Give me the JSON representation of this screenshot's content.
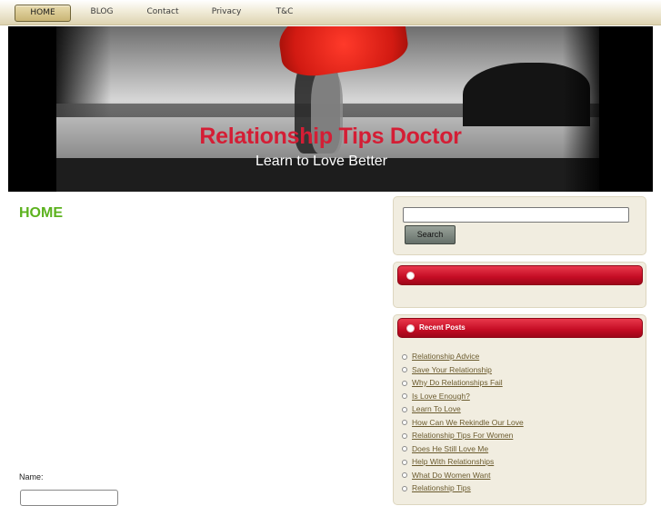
{
  "nav": {
    "items": [
      {
        "label": "HOME",
        "active": true
      },
      {
        "label": "BLOG",
        "active": false
      },
      {
        "label": "Contact",
        "active": false
      },
      {
        "label": "Privacy",
        "active": false
      },
      {
        "label": "T&C",
        "active": false
      }
    ]
  },
  "header": {
    "title": "Relationship Tips Doctor",
    "tagline": "Learn to Love Better"
  },
  "main": {
    "page_title": "HOME",
    "name_label": "Name:"
  },
  "sidebar": {
    "search_button_label": "Search",
    "blank_widget_title": "",
    "recent_posts_title": "Recent Posts",
    "recent_posts": [
      "Relationship Advice",
      "Save Your Relationship",
      "Why Do Relationships Fail",
      "Is Love Enough?",
      "Learn To Love",
      "How Can We Rekindle Our Love",
      "Relationship Tips For Women",
      "Does He Still Love Me",
      "Help With Relationships",
      "What Do Women Want",
      "Relationship Tips"
    ]
  },
  "colors": {
    "title_red": "#d41e35",
    "home_green": "#5cb21e",
    "widget_red": "#c40c24",
    "link_brown": "#6b5b2e"
  }
}
